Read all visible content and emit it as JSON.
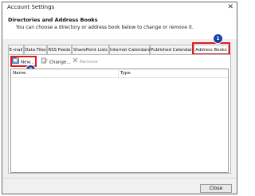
{
  "window": {
    "title": "Account Settings",
    "close_glyph": "✕"
  },
  "header": {
    "title": "Directories and Address Books",
    "description": "You can choose a directory or address book below to change or remove it."
  },
  "tabs": [
    {
      "label": "E-mail"
    },
    {
      "label": "Data Files"
    },
    {
      "label": "RSS Feeds"
    },
    {
      "label": "SharePoint Lists"
    },
    {
      "label": "Internet Calendars"
    },
    {
      "label": "Published Calendars"
    },
    {
      "label": "Address Books",
      "active": true
    }
  ],
  "toolbar": {
    "new_label": "New...",
    "change_label": "Change...",
    "remove_label": "Remove"
  },
  "list": {
    "columns": [
      "Name",
      "Type"
    ]
  },
  "annotations": {
    "badge1": "1",
    "badge2": "2",
    "highlight_color": "#e0191f",
    "badge_color": "#1f3fa6"
  },
  "footer": {
    "close_label": "Close"
  }
}
